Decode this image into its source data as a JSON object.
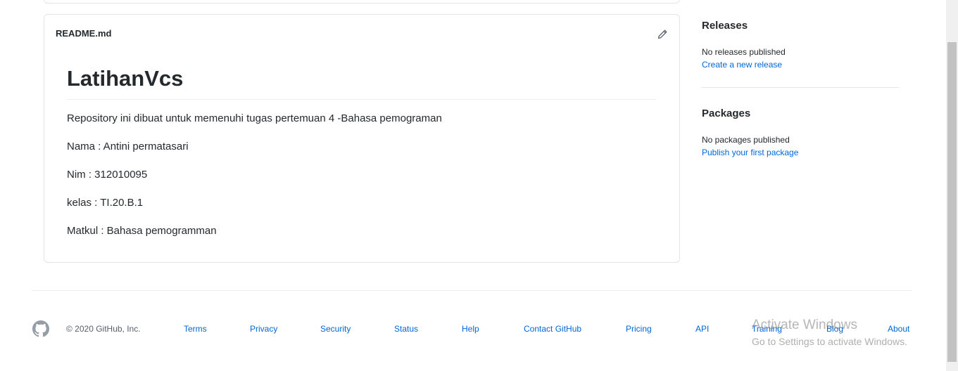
{
  "readme": {
    "filename": "README.md",
    "title": "LatihanVcs",
    "paragraphs": [
      "Repository ini dibuat untuk memenuhi tugas pertemuan 4 -Bahasa pemograman",
      "Nama : Antini permatasari",
      "Nim : 312010095",
      "kelas : TI.20.B.1",
      "Matkul : Bahasa pemogramman"
    ]
  },
  "sidebar": {
    "releases": {
      "heading": "Releases",
      "status": "No releases published",
      "link": "Create a new release"
    },
    "packages": {
      "heading": "Packages",
      "status": "No packages published",
      "link": "Publish your first package"
    }
  },
  "footer": {
    "copyright": "© 2020 GitHub, Inc.",
    "links": [
      "Terms",
      "Privacy",
      "Security",
      "Status",
      "Help",
      "Contact GitHub",
      "Pricing",
      "API",
      "Training",
      "Blog",
      "About"
    ]
  },
  "watermark": {
    "title": "Activate Windows",
    "subtitle": "Go to Settings to activate Windows."
  },
  "colors": {
    "link": "#0366d6",
    "text": "#24292e",
    "border": "#e1e4e8"
  }
}
